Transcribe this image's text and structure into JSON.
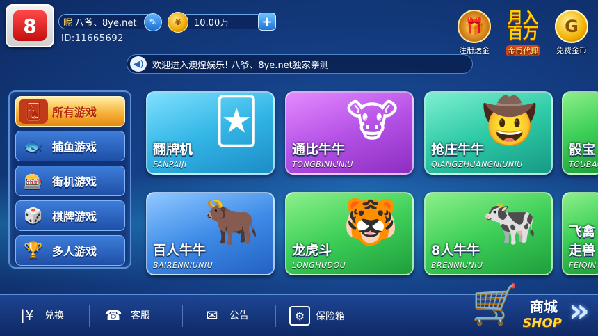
{
  "header": {
    "logo_text": "8",
    "nickname_label": "昵",
    "nickname": "八爷、8ye.net",
    "user_id": "ID:11665692",
    "coins": "10.00万",
    "plus": "+",
    "top_icons": [
      {
        "label": "注册送金",
        "icon": "treasure-chest"
      },
      {
        "label": "金币代理",
        "icon": "monthly-income",
        "title_top": "月入",
        "title_bottom": "百万"
      },
      {
        "label": "免费金币",
        "icon": "gold-coin"
      }
    ]
  },
  "notice": {
    "text": "欢迎进入澳煌娱乐! 八爷、8ye.net独家亲测"
  },
  "sidebar": {
    "items": [
      {
        "label": "所有游戏",
        "icon": "all-games",
        "active": true
      },
      {
        "label": "捕鱼游戏",
        "icon": "fish"
      },
      {
        "label": "街机游戏",
        "icon": "slot-machine"
      },
      {
        "label": "棋牌游戏",
        "icon": "cards-and-dice"
      },
      {
        "label": "多人游戏",
        "icon": "trophy"
      }
    ]
  },
  "games": [
    {
      "name": "翻牌机",
      "pinyin": "FANPAIJI",
      "color": "#33b6e6"
    },
    {
      "name": "通比牛牛",
      "pinyin": "TONGBINIUNIU",
      "color": "#b552e6"
    },
    {
      "name": "抢庄牛牛",
      "pinyin": "QIANGZHUANGNIUNIU",
      "color": "#2ecaa6"
    },
    {
      "name": "骰宝",
      "pinyin": "TOUBAO",
      "color": "#3dcf58"
    },
    {
      "name": "百人牛牛",
      "pinyin": "BAIRENNIUNIU",
      "color": "#3f8ce8"
    },
    {
      "name": "龙虎斗",
      "pinyin": "LONGHUDOU",
      "color": "#3dcf58"
    },
    {
      "name": "8人牛牛",
      "pinyin": "BRENNIUNIU",
      "color": "#3dcf58"
    },
    {
      "name": "飞禽走兽",
      "pinyin": "FEIQIN",
      "color": "#3dcf58"
    }
  ],
  "bottom": {
    "items": [
      {
        "label": "兑换",
        "icon": "yen-exchange"
      },
      {
        "label": "客服",
        "icon": "telephone"
      },
      {
        "label": "公告",
        "icon": "envelope"
      },
      {
        "label": "保险箱",
        "icon": "safe"
      }
    ],
    "shop_title": "商城",
    "shop_sub": "SHOP",
    "next_arrow": "»"
  }
}
